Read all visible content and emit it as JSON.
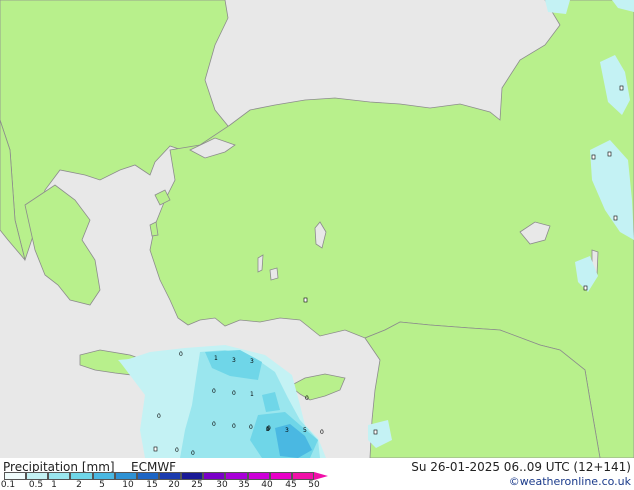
{
  "map": {
    "station_values": [
      "1",
      "3",
      "3",
      "0",
      "0",
      "1",
      "0",
      "0",
      "0",
      "0",
      "0",
      "0",
      "2",
      "3",
      "5",
      "0",
      "0",
      "0",
      "0",
      "0"
    ],
    "colors": {
      "land": "#b8f08c",
      "sea": "#e8e8e8",
      "coast": "#8c8c8c"
    }
  },
  "footer": {
    "title": "Precipitation [mm]",
    "model": "ECMWF",
    "datetime": "Su 26-01-2025 06..09 UTC (12+141)",
    "credit": "©weatheronline.co.uk",
    "scale_ticks": [
      "0.1",
      "0.5",
      "1",
      "2",
      "5",
      "10",
      "15",
      "20",
      "25",
      "30",
      "35",
      "40",
      "45",
      "50"
    ],
    "scale_colors": [
      "#f0fcfc",
      "#c4f2f4",
      "#9ae6ee",
      "#6fd6e8",
      "#4ab8e2",
      "#2e92d4",
      "#1e66c4",
      "#1c3cae",
      "#1a1a96",
      "#7a00c8",
      "#a800d8",
      "#cc00d8",
      "#e800c8",
      "#f010a8"
    ]
  }
}
